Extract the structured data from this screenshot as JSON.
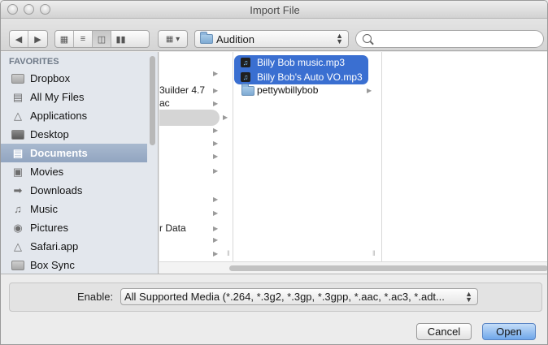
{
  "window": {
    "title": "Import File"
  },
  "toolbar": {
    "back_icon": "back-arrow-icon",
    "forward_icon": "forward-arrow-icon",
    "view_modes": [
      "icon-view",
      "list-view",
      "column-view",
      "coverflow-view"
    ],
    "active_view": "column-view",
    "path_popup": "Audition",
    "search_value": ""
  },
  "sidebar": {
    "header": "FAVORITES",
    "items": [
      {
        "label": "Dropbox",
        "icon": "folder-icon"
      },
      {
        "label": "All My Files",
        "icon": "all-files-icon"
      },
      {
        "label": "Applications",
        "icon": "applications-icon"
      },
      {
        "label": "Desktop",
        "icon": "desktop-icon"
      },
      {
        "label": "Documents",
        "icon": "documents-icon",
        "selected": true
      },
      {
        "label": "Movies",
        "icon": "movies-icon"
      },
      {
        "label": "Downloads",
        "icon": "downloads-icon"
      },
      {
        "label": "Music",
        "icon": "music-icon"
      },
      {
        "label": "Pictures",
        "icon": "pictures-icon"
      },
      {
        "label": "Safari.app",
        "icon": "safari-icon"
      },
      {
        "label": "Box Sync",
        "icon": "folder-icon"
      }
    ]
  },
  "columns": {
    "col1": [
      {
        "label": "3uilder 4.7"
      },
      {
        "label": "ac"
      },
      {
        "label": "r Data"
      }
    ],
    "col2": [
      {
        "label": "Billy Bob music.mp3",
        "type": "mp3",
        "selected": true
      },
      {
        "label": "Billy Bob's Auto VO.mp3",
        "type": "mp3",
        "selected": true
      },
      {
        "label": "pettywbillybob",
        "type": "folder",
        "selected": false
      }
    ]
  },
  "bottom": {
    "enable_label": "Enable:",
    "enable_value": "All Supported Media (*.264, *.3g2, *.3gp, *.3gpp, *.aac, *.ac3, *.adt...",
    "cancel_label": "Cancel",
    "open_label": "Open"
  },
  "colors": {
    "selection_blue": "#3a6fd1",
    "sidebar_bg": "#e3e7ed",
    "sidebar_selection": "#9aabc4"
  }
}
